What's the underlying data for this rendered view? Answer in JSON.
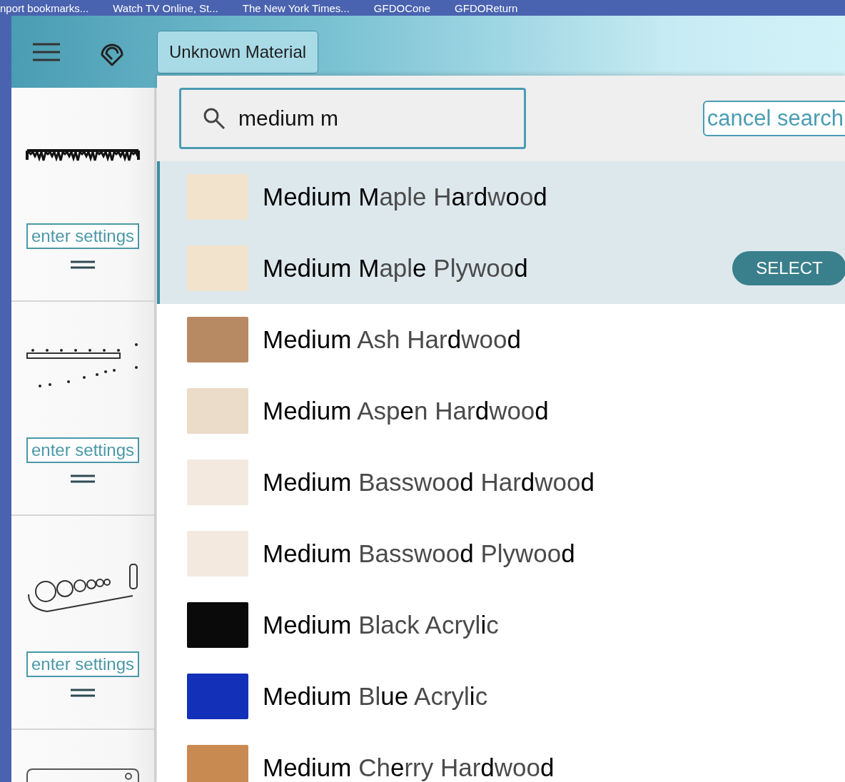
{
  "bookmarks": [
    "nport bookmarks...",
    "Watch TV Online, St...",
    "The New York Times...",
    "GFDOCone",
    "GFDOReturn"
  ],
  "header": {
    "material_button": "Unknown Material"
  },
  "sidebar": {
    "cards": [
      {
        "kind": "fringe",
        "button": "enter settings"
      },
      {
        "kind": "ruler",
        "button": "enter settings"
      },
      {
        "kind": "circles",
        "button": "enter settings"
      },
      {
        "kind": "frame"
      }
    ]
  },
  "search": {
    "value": "medium m",
    "cancel": "cancel search"
  },
  "materials": [
    {
      "name": "**Medium M**aple H**a**r**d**w**o**o**d**",
      "highlighted": true,
      "color": "#f1e3cc"
    },
    {
      "name": "**Medium M**apl**e** Plywoo**d**",
      "highlighted": true,
      "color": "#f1e3cc",
      "action": "SELECT"
    },
    {
      "name": "**Medium** Ash Har**d**woo**d**",
      "highlighted": false,
      "color": "#b78a63"
    },
    {
      "name": "**Medium** Asp**e**n Har**d**woo**d**",
      "highlighted": false,
      "color": "#eadcc8"
    },
    {
      "name": "**Medium** Basswoo**d** Har**d**woo**d**",
      "highlighted": false,
      "color": "#f3e9df"
    },
    {
      "name": "**Medium** Basswoo**d** Plywoo**d**",
      "highlighted": false,
      "color": "#f3e9df"
    },
    {
      "name": "**Medium** Black Acryl**i**c",
      "highlighted": false,
      "color": "#0a0a0a"
    },
    {
      "name": "**Medium** Bl**ue** Acryl**i**c",
      "highlighted": false,
      "color": "#1230b8"
    },
    {
      "name": "**Medium** Ch**e**rry Har**d**woo**d**",
      "highlighted": false,
      "color": "#c98a52"
    }
  ]
}
